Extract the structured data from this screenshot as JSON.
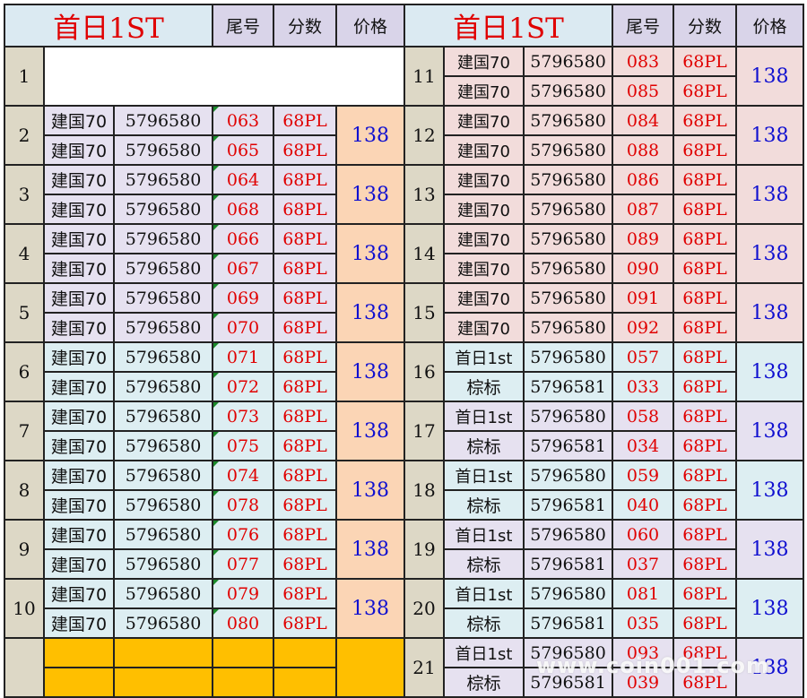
{
  "header": {
    "left_title": "首日1ST",
    "right_title": "首日1ST",
    "col_tail": "尾号",
    "col_score": "分数",
    "col_price": "价格"
  },
  "left_groups": [
    {
      "no": "1",
      "empty": true,
      "rows": []
    },
    {
      "no": "2",
      "price": "138",
      "rows": [
        {
          "name": "建国70",
          "code": "5796580",
          "tail": "063",
          "score": "68PL"
        },
        {
          "name": "建国70",
          "code": "5796580",
          "tail": "065",
          "score": "68PL"
        }
      ]
    },
    {
      "no": "3",
      "price": "138",
      "rows": [
        {
          "name": "建国70",
          "code": "5796580",
          "tail": "064",
          "score": "68PL"
        },
        {
          "name": "建国70",
          "code": "5796580",
          "tail": "068",
          "score": "68PL"
        }
      ]
    },
    {
      "no": "4",
      "price": "138",
      "rows": [
        {
          "name": "建国70",
          "code": "5796580",
          "tail": "066",
          "score": "68PL"
        },
        {
          "name": "建国70",
          "code": "5796580",
          "tail": "067",
          "score": "68PL"
        }
      ]
    },
    {
      "no": "5",
      "price": "138",
      "rows": [
        {
          "name": "建国70",
          "code": "5796580",
          "tail": "069",
          "score": "68PL"
        },
        {
          "name": "建国70",
          "code": "5796580",
          "tail": "070",
          "score": "68PL"
        }
      ]
    },
    {
      "no": "6",
      "price": "138",
      "rows": [
        {
          "name": "建国70",
          "code": "5796580",
          "tail": "071",
          "score": "68PL"
        },
        {
          "name": "建国70",
          "code": "5796580",
          "tail": "072",
          "score": "68PL"
        }
      ]
    },
    {
      "no": "7",
      "price": "138",
      "rows": [
        {
          "name": "建国70",
          "code": "5796580",
          "tail": "073",
          "score": "68PL"
        },
        {
          "name": "建国70",
          "code": "5796580",
          "tail": "075",
          "score": "68PL"
        }
      ]
    },
    {
      "no": "8",
      "price": "138",
      "rows": [
        {
          "name": "建国70",
          "code": "5796580",
          "tail": "074",
          "score": "68PL"
        },
        {
          "name": "建国70",
          "code": "5796580",
          "tail": "078",
          "score": "68PL"
        }
      ]
    },
    {
      "no": "9",
      "price": "138",
      "rows": [
        {
          "name": "建国70",
          "code": "5796580",
          "tail": "076",
          "score": "68PL"
        },
        {
          "name": "建国70",
          "code": "5796580",
          "tail": "077",
          "score": "68PL"
        }
      ]
    },
    {
      "no": "10",
      "price": "138",
      "rows": [
        {
          "name": "建国70",
          "code": "5796580",
          "tail": "079",
          "score": "68PL"
        },
        {
          "name": "建国70",
          "code": "5796580",
          "tail": "080",
          "score": "68PL"
        }
      ]
    },
    {
      "no": "",
      "empty": true,
      "rows": []
    }
  ],
  "right_groups": [
    {
      "no": "11",
      "price": "138",
      "rows": [
        {
          "name": "建国70",
          "code": "5796580",
          "tail": "083",
          "score": "68PL"
        },
        {
          "name": "建国70",
          "code": "5796580",
          "tail": "085",
          "score": "68PL"
        }
      ]
    },
    {
      "no": "12",
      "price": "138",
      "rows": [
        {
          "name": "建国70",
          "code": "5796580",
          "tail": "084",
          "score": "68PL"
        },
        {
          "name": "建国70",
          "code": "5796580",
          "tail": "088",
          "score": "68PL"
        }
      ]
    },
    {
      "no": "13",
      "price": "138",
      "rows": [
        {
          "name": "建国70",
          "code": "5796580",
          "tail": "086",
          "score": "68PL"
        },
        {
          "name": "建国70",
          "code": "5796580",
          "tail": "087",
          "score": "68PL"
        }
      ]
    },
    {
      "no": "14",
      "price": "138",
      "rows": [
        {
          "name": "建国70",
          "code": "5796580",
          "tail": "089",
          "score": "68PL"
        },
        {
          "name": "建国70",
          "code": "5796580",
          "tail": "090",
          "score": "68PL"
        }
      ]
    },
    {
      "no": "15",
      "price": "138",
      "rows": [
        {
          "name": "建国70",
          "code": "5796580",
          "tail": "091",
          "score": "68PL"
        },
        {
          "name": "建国70",
          "code": "5796580",
          "tail": "092",
          "score": "68PL"
        }
      ]
    },
    {
      "no": "16",
      "price": "138",
      "rows": [
        {
          "name": "首日1st",
          "code": "5796580",
          "tail": "057",
          "score": "68PL"
        },
        {
          "name": "棕标",
          "code": "5796581",
          "tail": "033",
          "score": "68PL"
        }
      ]
    },
    {
      "no": "17",
      "price": "138",
      "rows": [
        {
          "name": "首日1st",
          "code": "5796580",
          "tail": "058",
          "score": "68PL"
        },
        {
          "name": "棕标",
          "code": "5796581",
          "tail": "034",
          "score": "68PL"
        }
      ]
    },
    {
      "no": "18",
      "price": "138",
      "rows": [
        {
          "name": "首日1st",
          "code": "5796580",
          "tail": "059",
          "score": "68PL"
        },
        {
          "name": "棕标",
          "code": "5796581",
          "tail": "040",
          "score": "68PL"
        }
      ]
    },
    {
      "no": "19",
      "price": "138",
      "rows": [
        {
          "name": "首日1st",
          "code": "5796580",
          "tail": "060",
          "score": "68PL"
        },
        {
          "name": "棕标",
          "code": "5796581",
          "tail": "037",
          "score": "68PL"
        }
      ]
    },
    {
      "no": "20",
      "price": "138",
      "rows": [
        {
          "name": "首日1st",
          "code": "5796580",
          "tail": "081",
          "score": "68PL"
        },
        {
          "name": "棕标",
          "code": "5796581",
          "tail": "035",
          "score": "68PL"
        }
      ]
    },
    {
      "no": "21",
      "price": "138",
      "rows": [
        {
          "name": "首日1st",
          "code": "5796580",
          "tail": "093",
          "score": "68PL"
        },
        {
          "name": "棕标",
          "code": "5796581",
          "tail": "039",
          "score": "68PL"
        }
      ]
    }
  ],
  "watermark": "www.coin001.com",
  "colors": {
    "title_red": "#e00000",
    "price_blue": "#1010d0",
    "gold": "#ffbf00",
    "peach": "#fbd5b5",
    "pink": "#f2dcdb",
    "lavender": "#e6e1f0",
    "cyan": "#ddeef2"
  }
}
